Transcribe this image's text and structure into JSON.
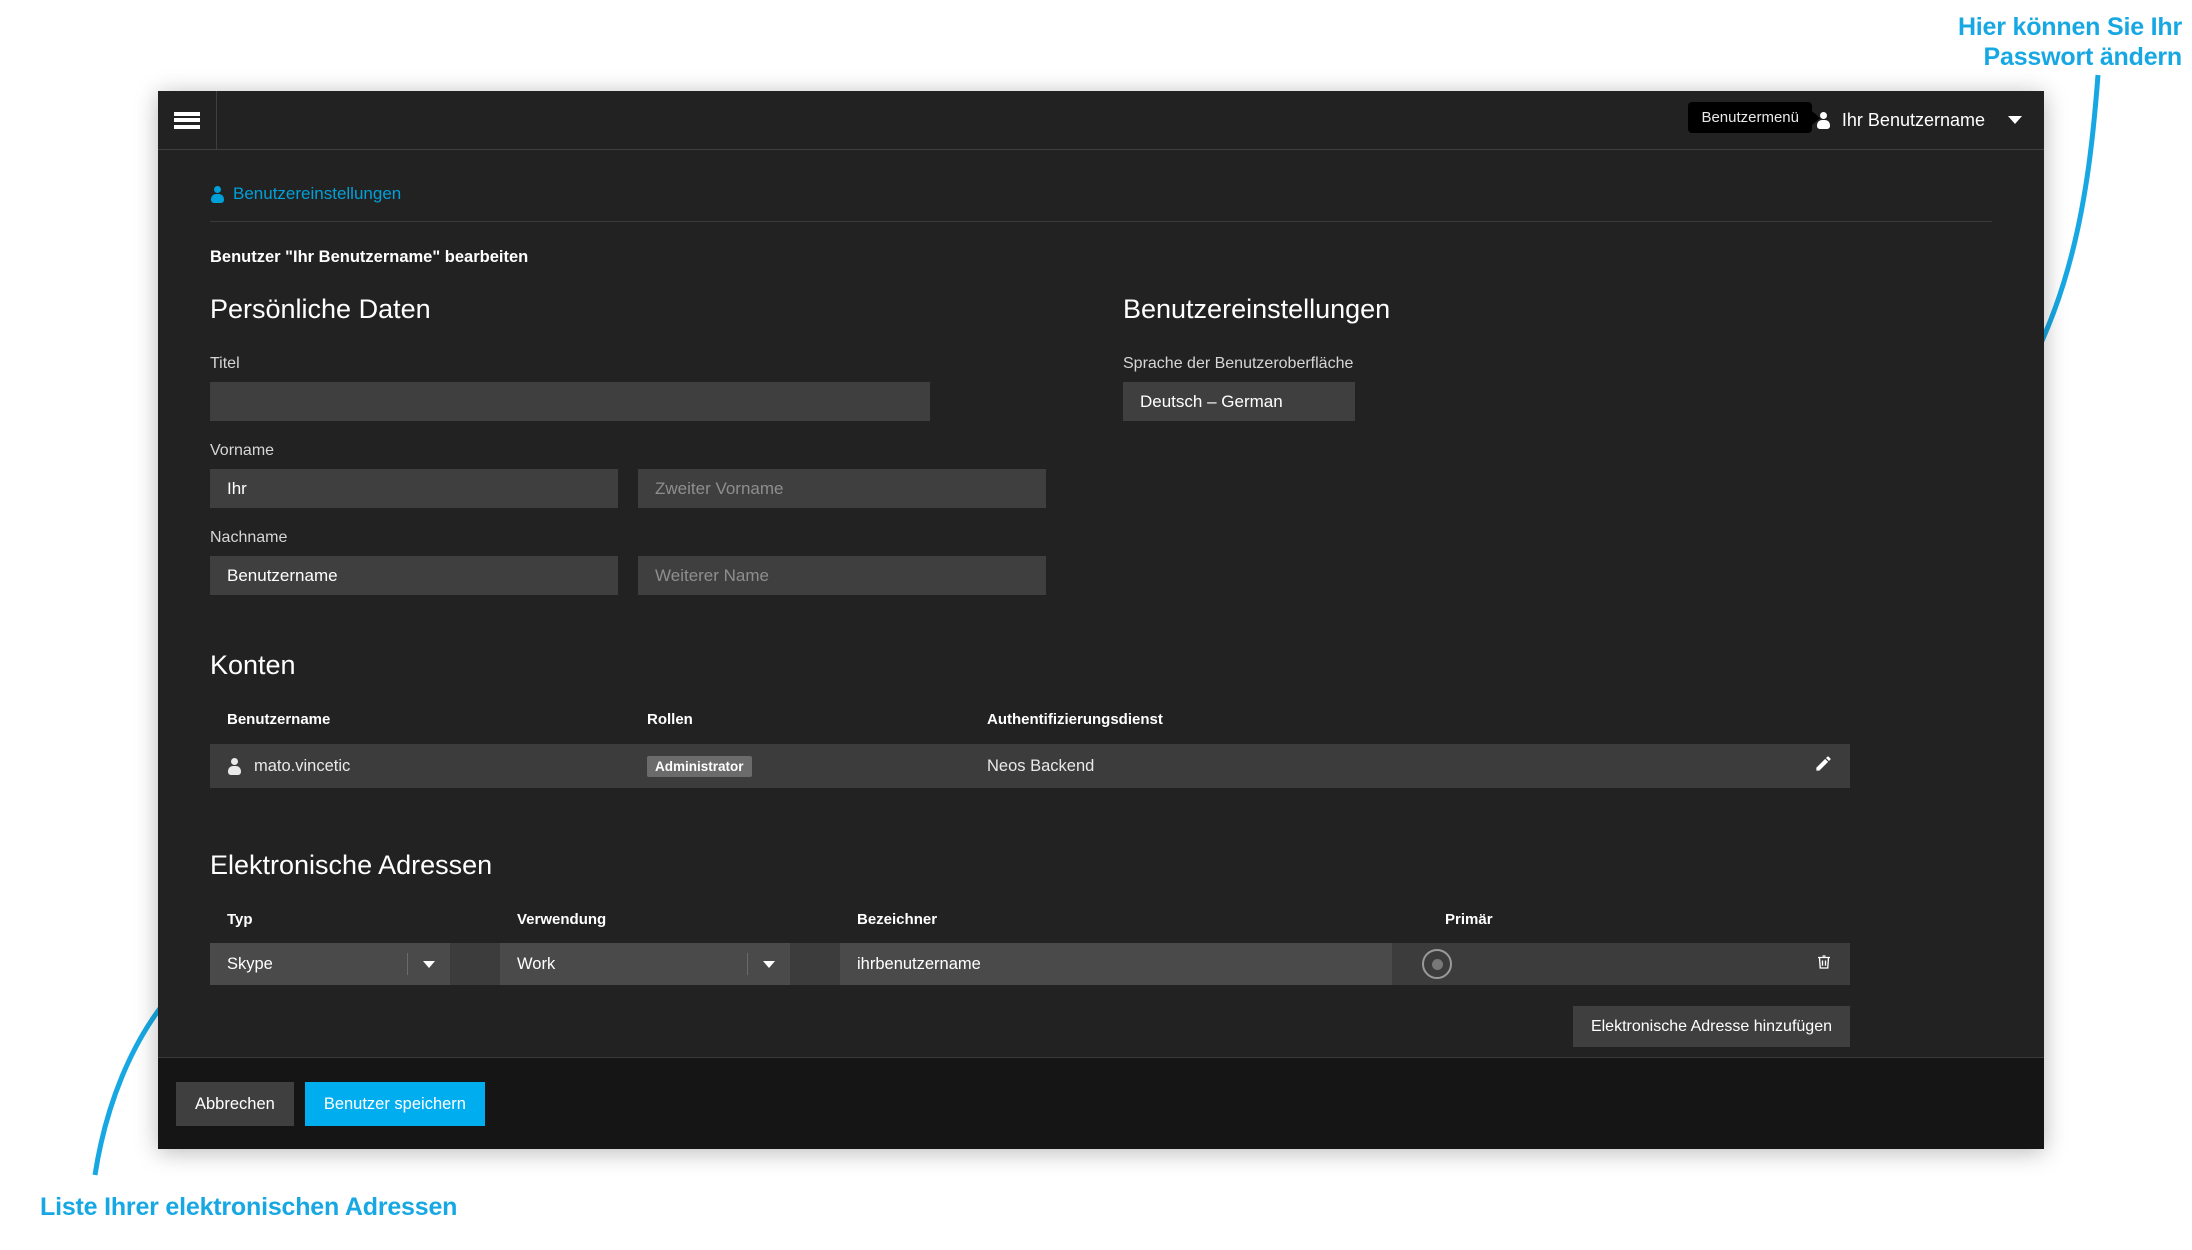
{
  "annotations": {
    "top_right": "Hier können Sie Ihr\nPasswort ändern",
    "top_right_line1": "Hier können Sie Ihr",
    "top_right_line2": "Passwort ändern",
    "bottom_left": "Liste Ihrer elektronischen Adressen",
    "color": "#17a8e3"
  },
  "topbar": {
    "menu_icon": "hamburger-icon",
    "tooltip": "Benutzermenü",
    "user_icon": "person-icon",
    "user_name": "Ihr Benutzername",
    "caret_icon": "chevron-down-icon"
  },
  "breadcrumb": {
    "icon": "person-icon",
    "label": "Benutzereinstellungen"
  },
  "page": {
    "edit_title": "Benutzer \"Ihr Benutzername\" bearbeiten"
  },
  "personal": {
    "section_title": "Persönliche Daten",
    "fields": {
      "title": {
        "label": "Titel",
        "value": "",
        "placeholder": ""
      },
      "firstname": {
        "label": "Vorname",
        "value": "Ihr",
        "placeholder": ""
      },
      "middlename": {
        "value": "",
        "placeholder": "Zweiter Vorname"
      },
      "lastname": {
        "label": "Nachname",
        "value": "Benutzername",
        "placeholder": ""
      },
      "othername": {
        "value": "",
        "placeholder": "Weiterer Name"
      }
    }
  },
  "settings": {
    "section_title": "Benutzereinstellungen",
    "language": {
      "label": "Sprache der Benutzeroberfläche",
      "value": "Deutsch – German"
    }
  },
  "accounts": {
    "section_title": "Konten",
    "columns": [
      "Benutzername",
      "Rollen",
      "Authentifizierungsdienst",
      ""
    ],
    "rows": [
      {
        "icon": "person-icon",
        "username": "mato.vincetic",
        "role": "Administrator",
        "auth_service": "Neos Backend",
        "action_icon": "pencil-icon"
      }
    ]
  },
  "eaddresses": {
    "section_title": "Elektronische Adressen",
    "columns": [
      "Typ",
      "Verwendung",
      "Bezeichner",
      "Primär",
      ""
    ],
    "rows": [
      {
        "type": "Skype",
        "usage": "Work",
        "identifier": "ihrbenutzername",
        "primary_selected": true,
        "delete_icon": "trash-icon"
      }
    ],
    "add_button": "Elektronische Adresse hinzufügen"
  },
  "footer": {
    "cancel": "Abbrechen",
    "save": "Benutzer speichern",
    "accent_color": "#00adef"
  }
}
